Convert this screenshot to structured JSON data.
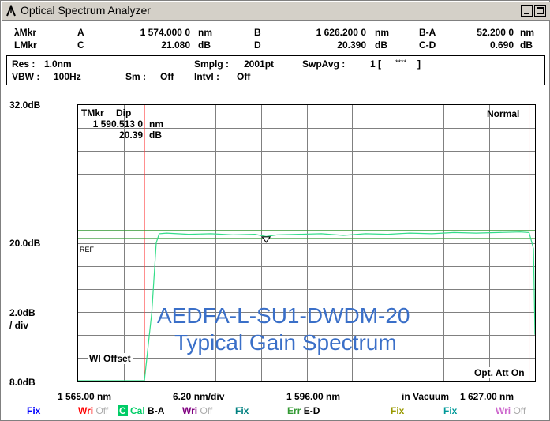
{
  "window": {
    "title": "Optical Spectrum Analyzer"
  },
  "markers": {
    "row1": {
      "lmkr_label": "λMkr",
      "a_label": "A",
      "a_value": "1 574.000 0",
      "a_unit": "nm",
      "b_label": "B",
      "b_value": "1 626.200 0",
      "b_unit": "nm",
      "ba_label": "B-A",
      "ba_value": "52.200 0",
      "ba_unit": "nm"
    },
    "row2": {
      "lmkr_label": "LMkr",
      "c_label": "C",
      "c_value": "21.080",
      "c_unit": "dB",
      "d_label": "D",
      "d_value": "20.390",
      "d_unit": "dB",
      "cd_label": "C-D",
      "cd_value": "0.690",
      "cd_unit": "dB"
    }
  },
  "settings": {
    "res_label": "Res :",
    "res_value": "1.0nm",
    "smplg_label": "Smplg :",
    "smplg_value": "2001pt",
    "swpavg_label": "SwpAvg :",
    "swpavg_value": "1 [",
    "swpavg_stars": "****",
    "swpavg_close": "]",
    "vbw_label": "VBW :",
    "vbw_value": "100Hz",
    "sm_label": "Sm :",
    "sm_value": "Off",
    "intvl_label": "Intvl :",
    "intvl_value": "Off"
  },
  "plot": {
    "y_top": "32.0dB",
    "y_ref": "20.0dB",
    "y_div": "2.0dB",
    "y_div_unit": "/ div",
    "y_bottom": "8.0dB",
    "tmkr_label": "TMkr",
    "dip_label": "Dip",
    "tmkr_wavelength": "1 590.513 0",
    "tmkr_wavelength_unit": "nm",
    "tmkr_level": "20.39",
    "tmkr_level_unit": "dB",
    "mode": "Normal",
    "ref_label": "REF",
    "wl_offset": "WI Offset",
    "opt_att": "Opt. Att On",
    "overlay_title": "AEDFA-L-SU1-DWDM-20",
    "overlay_subtitle": "Typical Gain Spectrum",
    "x_left": "1 565.00 nm",
    "x_div": "6.20 nm/div",
    "x_center": "1 596.00 nm",
    "x_medium": "in Vacuum",
    "x_right": "1 627.00 nm"
  },
  "traces": [
    {
      "name": "Fix",
      "color": "#0000ff",
      "state": ""
    },
    {
      "name": "Wri",
      "color": "#ff0000",
      "state": "Off"
    },
    {
      "name": "Cal",
      "prefix": "C",
      "color": "#00cc66",
      "state": "B-A"
    },
    {
      "name": "Wri",
      "color": "#800080",
      "state": "Off"
    },
    {
      "name": "Fix",
      "color": "#008080",
      "state": ""
    },
    {
      "name": "Err",
      "color": "#339933",
      "state": "E-D"
    },
    {
      "name": "Fix",
      "color": "#999900",
      "state": ""
    },
    {
      "name": "Fix",
      "color": "#009999",
      "state": ""
    },
    {
      "name": "Wri",
      "color": "#cc66cc",
      "state": "Off"
    }
  ],
  "chart_data": {
    "type": "line",
    "xlim": [
      1565.0,
      1627.0
    ],
    "ylim": [
      8.0,
      32.0
    ],
    "x_divisions": 10,
    "y_divisions": 12,
    "grid": true,
    "reference_level": 20.0,
    "markers": {
      "A": 1574.0,
      "B": 1626.2,
      "C_level": 21.08,
      "D_level": 20.39
    },
    "trace": {
      "x": [
        1565.0,
        1574.0,
        1575.0,
        1575.6,
        1576.0,
        1577.0,
        1580.0,
        1583.0,
        1586.0,
        1589.0,
        1590.5,
        1592.0,
        1595.0,
        1598.0,
        1601.0,
        1604.0,
        1607.0,
        1610.0,
        1613.0,
        1616.0,
        1619.0,
        1622.0,
        1625.0,
        1626.2,
        1626.8,
        1627.0
      ],
      "y": [
        8.0,
        8.0,
        14.0,
        20.0,
        20.8,
        20.85,
        20.75,
        20.8,
        20.7,
        20.75,
        20.55,
        20.7,
        20.75,
        20.8,
        20.65,
        20.8,
        20.75,
        20.85,
        20.8,
        20.9,
        20.85,
        20.9,
        20.95,
        20.9,
        19.5,
        12.0
      ]
    }
  }
}
